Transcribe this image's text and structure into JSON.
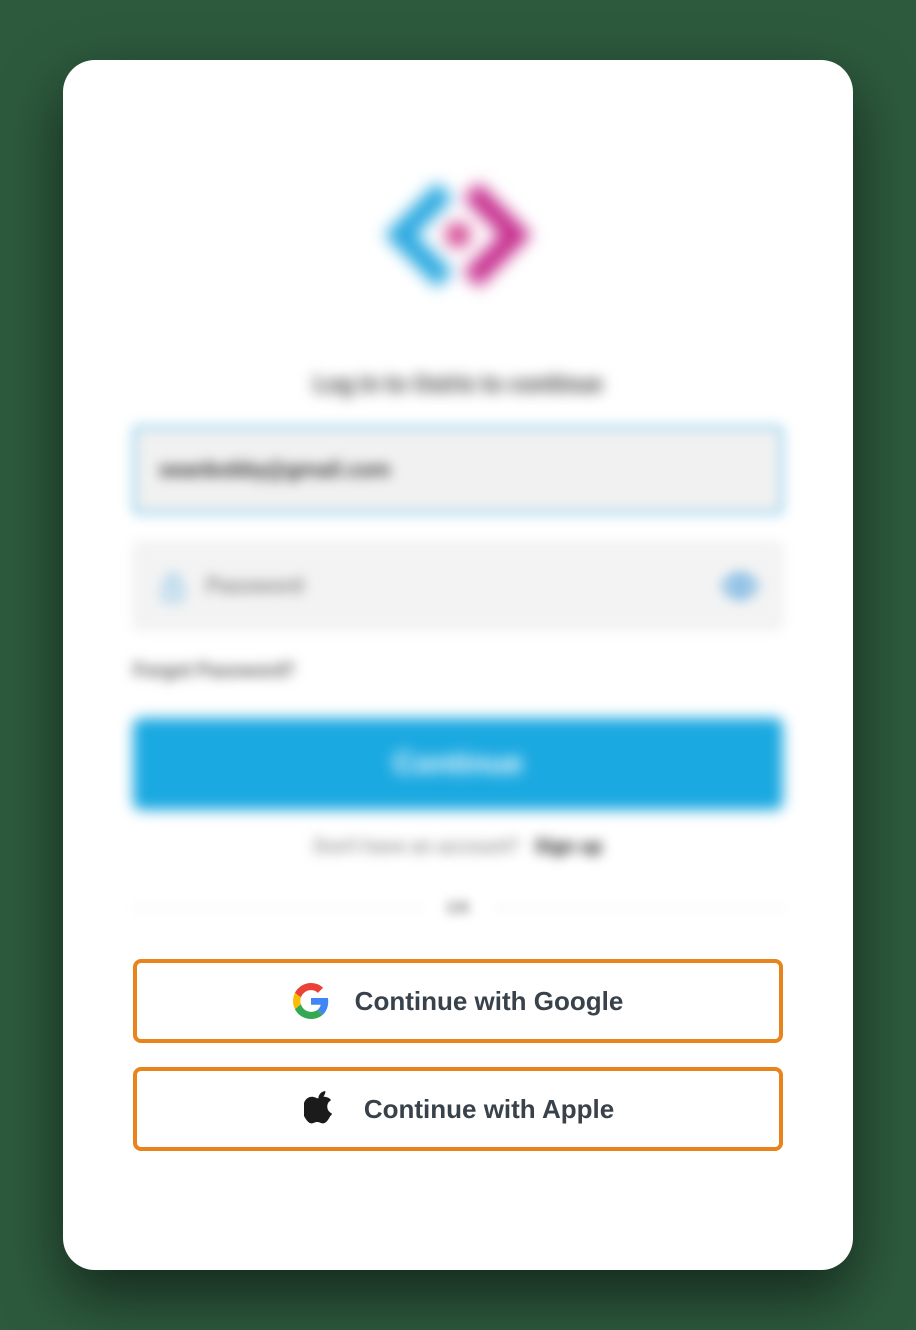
{
  "heading": "Log in to Osiris to continue",
  "email": {
    "value": "seanbobby@gmail.com"
  },
  "password": {
    "placeholder": "Password"
  },
  "forgot_label": "Forgot Password?",
  "continue_label": "Continue",
  "signup": {
    "prompt": "Don't have an account?",
    "link": "Sign up"
  },
  "divider_label": "OR",
  "sso": {
    "google": "Continue with Google",
    "apple": "Continue with Apple"
  },
  "colors": {
    "accent": "#1ba9e1",
    "highlight_border": "#e8841b"
  }
}
